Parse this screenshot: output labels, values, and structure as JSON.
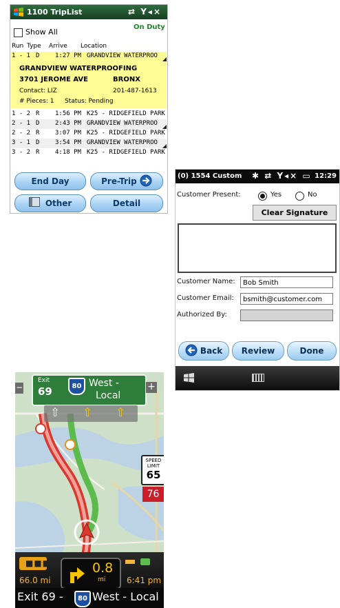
{
  "triplist": {
    "title": "1100 TripList",
    "show_all_label": "Show All",
    "duty_status": "On Duty",
    "columns": [
      "Run",
      "Type",
      "Arrive",
      "Location"
    ],
    "selected": {
      "run": "1 - 1",
      "type": "D",
      "arrive": "1:27 PM",
      "location": "GRANDVIEW WATERPROO",
      "company": "GRANDVIEW WATERPROOFING",
      "address": "3701 JEROME AVE",
      "borough": "BRONX",
      "contact": "Contact: LIZ",
      "phone": "201-487-1613",
      "pieces": "# Pieces: 1",
      "status": "Status: Pending"
    },
    "rows": [
      {
        "run": "1 - 2",
        "type": "R",
        "arrive": "1:56 PM",
        "location": "K25 - RIDGEFIELD PARK"
      },
      {
        "run": "2 - 1",
        "type": "D",
        "arrive": "2:43 PM",
        "location": "GRANDVIEW WATERPROO"
      },
      {
        "run": "2 - 2",
        "type": "R",
        "arrive": "3:07 PM",
        "location": "K25 - RIDGEFIELD PARK"
      },
      {
        "run": "3 - 1",
        "type": "D",
        "arrive": "3:54 PM",
        "location": "GRANDVIEW WATERPROO"
      },
      {
        "run": "3 - 2",
        "type": "R",
        "arrive": "4:18 PM",
        "location": "K25 - RIDGEFIELD PARK"
      }
    ],
    "buttons": {
      "end_day": "End Day",
      "pre_trip": "Pre-Trip",
      "other": "Other",
      "detail": "Detail"
    }
  },
  "signature": {
    "title": "(0) 1554 Custom",
    "time": "12:29",
    "customer_present_label": "Customer Present:",
    "yes_label": "Yes",
    "no_label": "No",
    "selected": "Yes",
    "clear_signature": "Clear Signature",
    "customer_name_label": "Customer Name:",
    "customer_name_value": "Bob Smith",
    "customer_email_label": "Customer Email:",
    "customer_email_value": "bsmith@customer.com",
    "authorized_by_label": "Authorized By:",
    "authorized_by_value": "",
    "buttons": {
      "back": "Back",
      "review": "Review",
      "done": "Done"
    }
  },
  "navigation": {
    "exit_label": "Exit",
    "exit_number": "69",
    "interstate": "80",
    "direction": "West -",
    "lane": "Local",
    "speed_limit_label": "SPEED LIMIT",
    "speed_limit": "65",
    "current_speed": "76",
    "distance_remaining": "66.0 mi",
    "turn_distance": "0.8",
    "turn_unit": "mi",
    "eta": "6:41 pm",
    "bottom_prefix": "Exit 69 -",
    "bottom_suffix": "West - Local",
    "colors": {
      "route": "#5dbb4e",
      "sign_green": "#2f7d3b",
      "highway_red": "#d9392d"
    }
  }
}
